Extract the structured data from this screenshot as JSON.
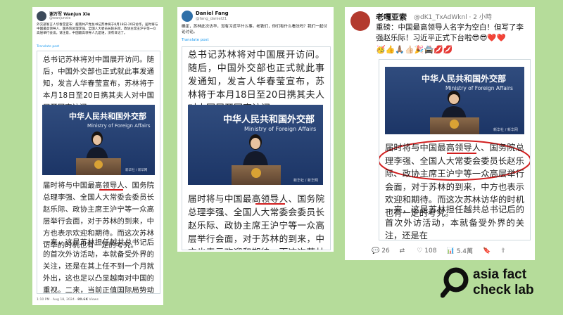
{
  "panel1": {
    "name": "谢万军 Wanjun Xie",
    "handle": "@wanjunxie",
    "tweet": "外交部发言人华春莹宣布：越南共产党总书记苏林将于8月18日-20日访华，届时将与中国最高领导人、国务院总理李强、全国人大委员长赵乐际、政协主席王沪宁等一众高层举行会谈。请注意，中国最高领导人几是谁，没有日记了。",
    "translate": "Translate post",
    "article_top": "总书记苏林将对中国展开访问。随后，中国外交部也正式就此事发通知，发言人华春莹宣布，苏林将于本月18日至20日携其夫人对中国展开国事访问。",
    "photo_chars": "中华人民共和国外交部",
    "photo_en": "Ministry of Foreign Affairs",
    "photo_watermark": "新华社 / 新华网",
    "article_bottom": "届时将与中国最高领导人、国务院总理李强、全国人大常委会委员长赵乐际、政协主席王沪宁等一众高层举行会面，对于苏林的到来，中方也表示欢迎和期待。而这次苏林访华的时机也有一定的考究。",
    "article_more": "一来，这是苏林担任越共总书记后的首次外访活动，本就备受外界的关注，还是在其上任不到一个月就外出，这也足以凸显越南对中国的重视。二来，当前正值国际局势动荡之际，美国不断将手伸向亚太地区，南海局势也较为紧张。",
    "footer_time": "1:10 PM · Aug 18, 2024 · ",
    "footer_views": "80.6K",
    "footer_views_label": " Views"
  },
  "panel2": {
    "name": "Daniel Fang",
    "handle": "@fang_daniel21",
    "tweet": "确定，苏林此次访华，没有习近平什么事。老铁们，你们有什么看法吗？我们一起讨论讨论。",
    "translate": "Translate post",
    "article_top": "总书记苏林将对中国展开访问。随后，中国外交部也正式就此事发通知，发言人华春莹宣布，苏林将于本月18日至20日携其夫人对中国展开国事访问。",
    "photo_chars": "中华人民共和国外交部",
    "photo_en": "Ministry of Foreign Affairs",
    "photo_watermark": "新华社 / 新华网",
    "article_bottom": "届时将与中国最高领导人、国务院总理李强、全国人大常委会委员长赵乐际、政协主席王沪宁等一众高层举行会面，对于苏林的到来，中方也表示欢迎和期待。而这次苏林访华的时机也有一定的考究。"
  },
  "panel3": {
    "name": "老嘎亚索",
    "handle": "@dK1_TxAdWknl · 2 小時",
    "tweet": "重磅：中国最高领导人名字为空白！但写了李强赵乐际！习近平正式下台啦😎😎❤️❤️",
    "emoji_line": "🥳👍🙏🏽👍🏻🎉🚔💋💋",
    "photo_chars": "中华人民共和国外交部",
    "photo_en": "Ministry of Foreign Affairs",
    "photo_watermark": "新华社 / 新华网",
    "article_bottom": "届时将与中国最高领导人、国务院总理李强、全国人大常委会委员长赵乐际、政协主席王沪宁等一众高层举行会面，对于苏林的到来，中方也表示欢迎和期待。而这次苏林访华的时机也有一定的考究。",
    "article_more": "一来，这是苏林担任越共总书记后的首次外访活动，本就备受外界的关注，还是在",
    "actions": {
      "reply": "26",
      "retweet": "",
      "like": "108",
      "views": "5.4萬"
    }
  },
  "logo": {
    "line1": "asia fact",
    "line2": "check lab"
  },
  "colors": {
    "background": "#b5dc9a",
    "underline": "#d11f1f",
    "link": "#1d9bf0"
  }
}
